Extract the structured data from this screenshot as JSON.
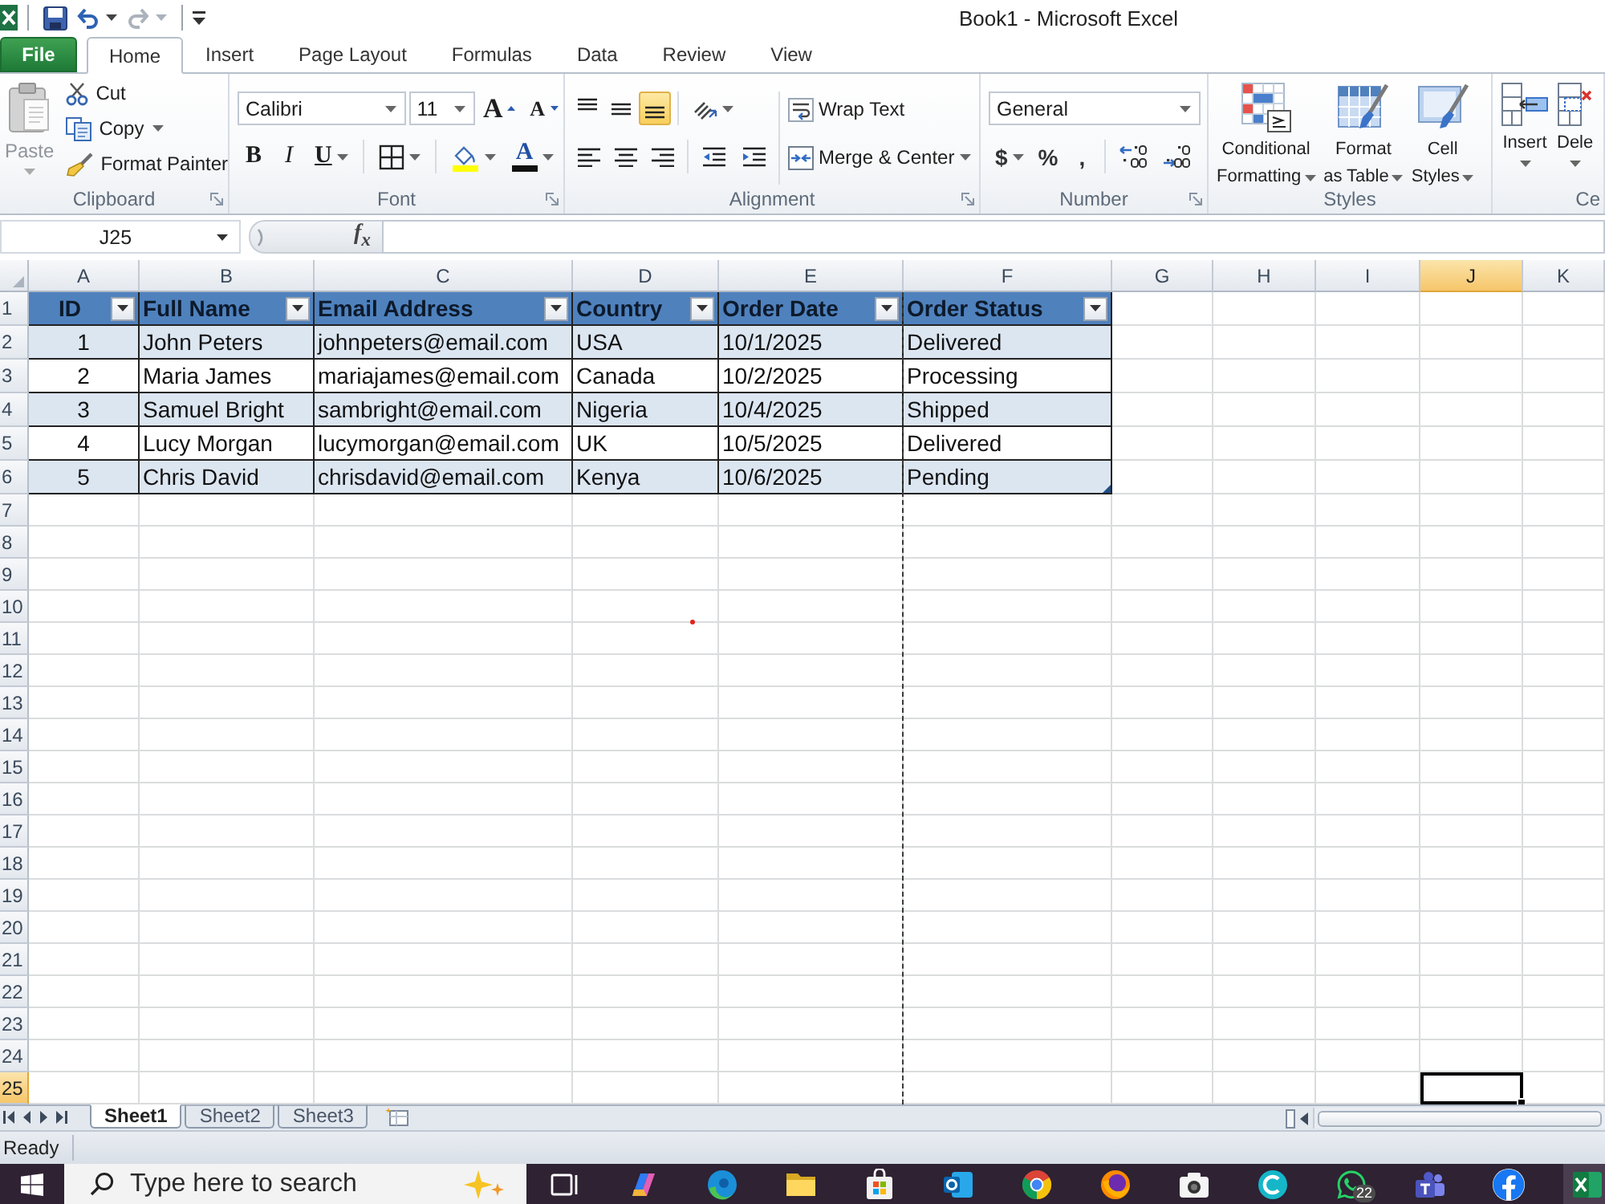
{
  "title_bar": {
    "title": "Book1 - Microsoft Excel"
  },
  "tabs": [
    {
      "label": "File",
      "kind": "file",
      "selected": false
    },
    {
      "label": "Home",
      "kind": "tab",
      "selected": true
    },
    {
      "label": "Insert",
      "kind": "tab",
      "selected": false
    },
    {
      "label": "Page Layout",
      "kind": "tab",
      "selected": false
    },
    {
      "label": "Formulas",
      "kind": "tab",
      "selected": false
    },
    {
      "label": "Data",
      "kind": "tab",
      "selected": false
    },
    {
      "label": "Review",
      "kind": "tab",
      "selected": false
    },
    {
      "label": "View",
      "kind": "tab",
      "selected": false
    }
  ],
  "ribbon": {
    "clipboard": {
      "label": "Clipboard",
      "paste": {
        "label": "Paste",
        "disabled": true
      },
      "cut": "Cut",
      "copy": "Copy",
      "format_painter": "Format Painter"
    },
    "font": {
      "label": "Font",
      "font_name": "Calibri",
      "font_size": "11",
      "grow_font": "A",
      "shrink_font": "A",
      "bold": "B",
      "italic": "I",
      "underline": "U",
      "font_color": "A"
    },
    "alignment": {
      "label": "Alignment",
      "vertical_align": [
        {
          "kind": "top",
          "selected": false
        },
        {
          "kind": "middle",
          "selected": false
        },
        {
          "kind": "bottom",
          "selected": true
        }
      ],
      "horizontal_align": [
        {
          "kind": "left",
          "selected": false
        },
        {
          "kind": "center",
          "selected": false
        },
        {
          "kind": "right",
          "selected": false
        }
      ],
      "wrap_text": "Wrap Text",
      "merge_center": "Merge & Center"
    },
    "number": {
      "label": "Number",
      "format": "General",
      "currency": "$",
      "percent": "%",
      "comma": ","
    },
    "styles": {
      "label": "Styles",
      "buttons": [
        {
          "kind": "conditional",
          "lines": [
            "Conditional",
            "Formatting"
          ]
        },
        {
          "kind": "table",
          "lines": [
            "Format",
            "as Table"
          ]
        },
        {
          "kind": "cell",
          "lines": [
            "Cell",
            "Styles"
          ]
        }
      ]
    },
    "cells": {
      "label": "Ce",
      "buttons": [
        {
          "kind": "insert",
          "label": "Insert"
        },
        {
          "kind": "delete",
          "label": "Dele"
        }
      ]
    }
  },
  "formula_bar": {
    "name_box": "J25",
    "function_label": "f$_{x}$"
  },
  "sheet": {
    "columns": [
      {
        "label": "A",
        "selected": false
      },
      {
        "label": "B",
        "selected": false
      },
      {
        "label": "C",
        "selected": false
      },
      {
        "label": "D",
        "selected": false
      },
      {
        "label": "E",
        "selected": false
      },
      {
        "label": "F",
        "selected": false
      },
      {
        "label": "G",
        "selected": false
      },
      {
        "label": "H",
        "selected": false
      },
      {
        "label": "I",
        "selected": false
      },
      {
        "label": "J",
        "selected": true
      },
      {
        "label": "K",
        "selected": false
      }
    ],
    "rows": [
      {
        "label": "1",
        "selected": false
      },
      {
        "label": "2",
        "selected": false
      },
      {
        "label": "3",
        "selected": false
      },
      {
        "label": "4",
        "selected": false
      },
      {
        "label": "5",
        "selected": false
      },
      {
        "label": "6",
        "selected": false
      },
      {
        "label": "7",
        "selected": false
      },
      {
        "label": "8",
        "selected": false
      },
      {
        "label": "9",
        "selected": false
      },
      {
        "label": "10",
        "selected": false
      },
      {
        "label": "11",
        "selected": false
      },
      {
        "label": "12",
        "selected": false
      },
      {
        "label": "13",
        "selected": false
      },
      {
        "label": "14",
        "selected": false
      },
      {
        "label": "15",
        "selected": false
      },
      {
        "label": "16",
        "selected": false
      },
      {
        "label": "17",
        "selected": false
      },
      {
        "label": "18",
        "selected": false
      },
      {
        "label": "19",
        "selected": false
      },
      {
        "label": "20",
        "selected": false
      },
      {
        "label": "21",
        "selected": false
      },
      {
        "label": "22",
        "selected": false
      },
      {
        "label": "23",
        "selected": false
      },
      {
        "label": "24",
        "selected": false
      },
      {
        "label": "25",
        "selected": true
      }
    ],
    "table": {
      "headers": [
        "ID",
        "Full Name",
        "Email Address",
        "Country",
        "Order Date",
        "Order Status"
      ],
      "rows": [
        [
          "1",
          "John Peters",
          "johnpeters@email.com",
          "USA",
          "10/1/2025",
          "Delivered"
        ],
        [
          "2",
          "Maria James",
          "mariajames@email.com",
          "Canada",
          "10/2/2025",
          "Processing"
        ],
        [
          "3",
          "Samuel Bright",
          "sambright@email.com",
          "Nigeria",
          "10/4/2025",
          "Shipped"
        ],
        [
          "4",
          "Lucy Morgan",
          "lucymorgan@email.com",
          "UK",
          "10/5/2025",
          "Delivered"
        ],
        [
          "5",
          "Chris David",
          "chrisdavid@email.com",
          "Kenya",
          "10/6/2025",
          "Pending"
        ]
      ]
    }
  },
  "sheet_tabs": [
    {
      "label": "Sheet1",
      "selected": true
    },
    {
      "label": "Sheet2",
      "selected": false
    },
    {
      "label": "Sheet3",
      "selected": false
    }
  ],
  "status_bar": {
    "text": "Ready"
  },
  "taskbar": {
    "search": {
      "placeholder": "Type here to search"
    },
    "badge": "22"
  }
}
